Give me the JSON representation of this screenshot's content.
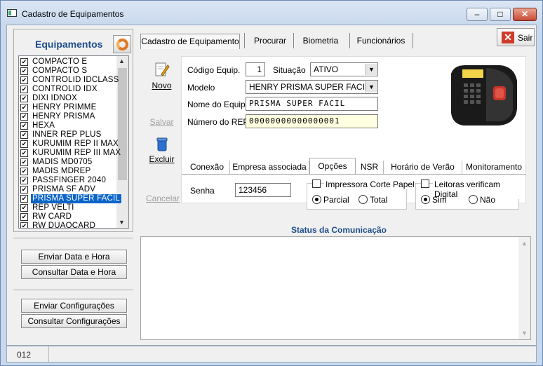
{
  "window": {
    "title": "Cadastro de Equipamentos"
  },
  "left": {
    "title": "Equipamentos",
    "items": [
      {
        "label": "COMPACTO E",
        "checked": true
      },
      {
        "label": "COMPACTO S",
        "checked": true
      },
      {
        "label": "CONTROLID IDCLASS",
        "checked": true
      },
      {
        "label": "CONTROLID IDX",
        "checked": true
      },
      {
        "label": "DIXI IDNOX",
        "checked": true
      },
      {
        "label": "HENRY PRIMME",
        "checked": true
      },
      {
        "label": "HENRY PRISMA",
        "checked": true
      },
      {
        "label": "HEXA",
        "checked": true
      },
      {
        "label": "INNER REP PLUS",
        "checked": true
      },
      {
        "label": "KURUMIM REP II MAX",
        "checked": true
      },
      {
        "label": "KURUMIM REP III MAX",
        "checked": true
      },
      {
        "label": "MADIS MD0705",
        "checked": true
      },
      {
        "label": "MADIS MDREP",
        "checked": true
      },
      {
        "label": "PASSFINGER 2040",
        "checked": true
      },
      {
        "label": "PRISMA SF ADV",
        "checked": true
      },
      {
        "label": "PRISMA SUPER FACIL",
        "checked": true,
        "selected": true
      },
      {
        "label": "REP VELTI",
        "checked": true
      },
      {
        "label": "RW CARD",
        "checked": true
      },
      {
        "label": "RW DUAOCARD",
        "checked": true
      }
    ],
    "btn_enviar_data": "Enviar Data e Hora",
    "btn_consultar_data": "Consultar Data e Hora",
    "btn_enviar_config": "Enviar Configurações",
    "btn_consultar_config": "Consultar Configurações"
  },
  "tabs": [
    "Cadastro de Equipamento",
    "Procurar",
    "Biometria",
    "Funcionários"
  ],
  "sair": "Sair",
  "actions": {
    "novo": "Novo",
    "salvar": "Salvar",
    "excluir": "Excluir",
    "cancelar": "Cancelar"
  },
  "form": {
    "codigo_label": "Código Equip.",
    "codigo_value": "1",
    "situacao_label": "Situação",
    "situacao_value": "ATIVO",
    "modelo_label": "Modelo",
    "modelo_value": "HENRY PRISMA SUPER FACIL",
    "nome_label": "Nome do Equip.",
    "nome_value": "PRISMA SUPER FACIL",
    "numero_label": "Número do REP",
    "numero_value": "00000000000000001"
  },
  "inner_tabs": [
    "Conexão",
    "Empresa associada",
    "Opções",
    "NSR",
    "Horário de Verão",
    "Monitoramento"
  ],
  "opcoes": {
    "senha_label": "Senha",
    "senha_value": "123456",
    "impressora_label": "Impressora Corte Papel",
    "parcial": "Parcial",
    "total": "Total",
    "leitoras_label": "Leitoras verificam Digital",
    "sim": "Sim",
    "nao": "Não"
  },
  "status": {
    "title": "Status da Comunicação"
  },
  "statusbar": {
    "code": "012"
  }
}
